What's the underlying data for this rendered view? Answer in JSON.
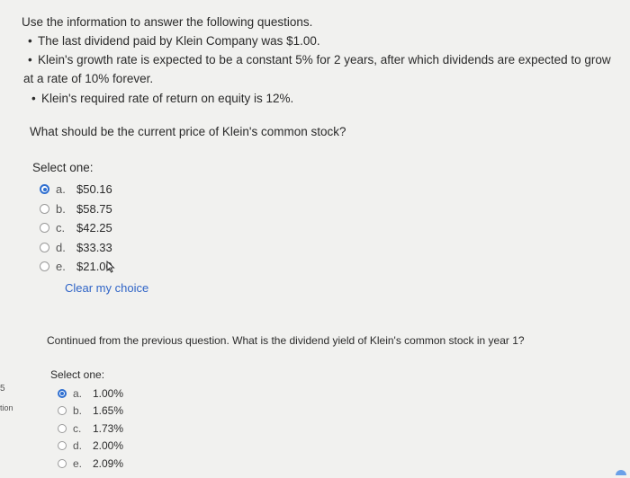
{
  "question1": {
    "intro": "Use the information to answer the following questions.",
    "bullets": [
      "The last dividend paid by Klein Company was $1.00.",
      "Klein's growth rate is expected to be a constant 5% for 2 years, after which dividends are expected to grow",
      "at a rate of 10% forever.",
      "Klein's required rate of return on equity is 12%."
    ],
    "question": "What should be the current price of Klein's common stock?",
    "select_label": "Select one:",
    "options": [
      {
        "letter": "a.",
        "value": "$50.16",
        "selected": true
      },
      {
        "letter": "b.",
        "value": "$58.75",
        "selected": false
      },
      {
        "letter": "c.",
        "value": "$42.25",
        "selected": false
      },
      {
        "letter": "d.",
        "value": "$33.33",
        "selected": false
      },
      {
        "letter": "e.",
        "value": "$21.00",
        "selected": false
      }
    ],
    "clear_label": "Clear my choice"
  },
  "question2": {
    "question": "Continued from the previous question. What is the dividend yield of Klein's common stock in year 1?",
    "select_label": "Select one:",
    "options": [
      {
        "letter": "a.",
        "value": "1.00%",
        "selected": true
      },
      {
        "letter": "b.",
        "value": "1.65%",
        "selected": false
      },
      {
        "letter": "c.",
        "value": "1.73%",
        "selected": false
      },
      {
        "letter": "d.",
        "value": "2.00%",
        "selected": false
      },
      {
        "letter": "e.",
        "value": "2.09%",
        "selected": false
      }
    ]
  },
  "sidebar": {
    "fragment1": "5",
    "fragment2": "tion"
  },
  "colors": {
    "accent": "#2f6fd0",
    "link": "#2f64c7",
    "background": "#f1f1ef"
  }
}
